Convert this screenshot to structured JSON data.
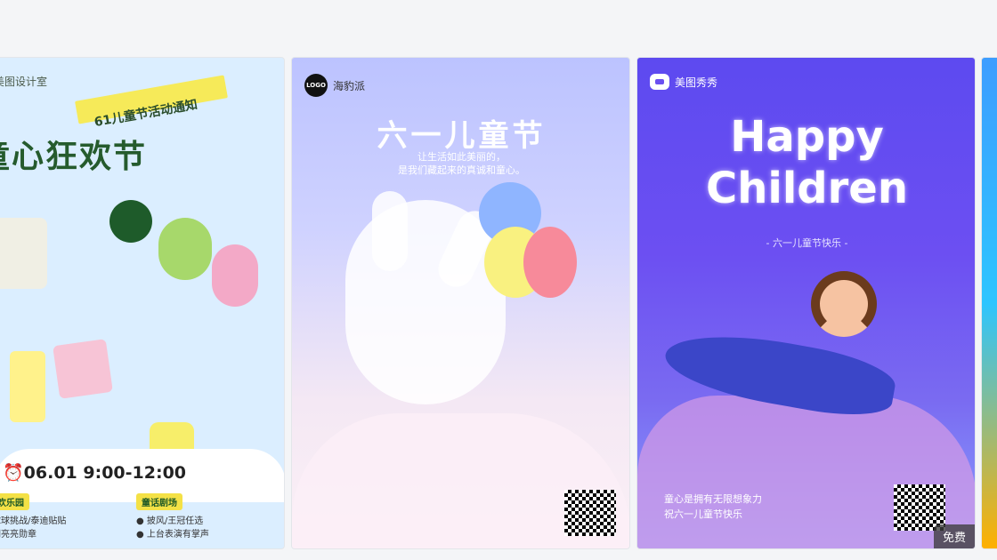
{
  "cards": [
    {
      "brand": "美图设计室",
      "ribbon": "61儿童节活动通知",
      "headline": "童心狂欢节",
      "date_line": "06.01   9:00-12:00",
      "left_tag": "欢乐园",
      "left_lines": [
        "球球挑战/泰迪贴贴",
        "闪亮亮勋章"
      ],
      "right_tag": "童话剧场",
      "right_lines": [
        "披风/王冠任选",
        "上台表演有掌声"
      ]
    },
    {
      "brand": "海豹派",
      "logo_text": "LOGO",
      "title": "六一儿童节",
      "subtitle_1": "让生活如此美丽的，",
      "subtitle_2": "是我们藏起来的真诚和童心。"
    },
    {
      "brand": "美图秀秀",
      "title_1": "Happy",
      "title_2": "Children",
      "subtitle": "- 六一儿童节快乐 -",
      "caption_1": "童心是拥有无限想象力",
      "caption_2": "祝六一儿童节快乐",
      "badge": "免费"
    }
  ],
  "colors": {
    "background": "#f4f5f7",
    "card3_accent": "#6c4ff2",
    "card1_text": "#255b2d"
  }
}
